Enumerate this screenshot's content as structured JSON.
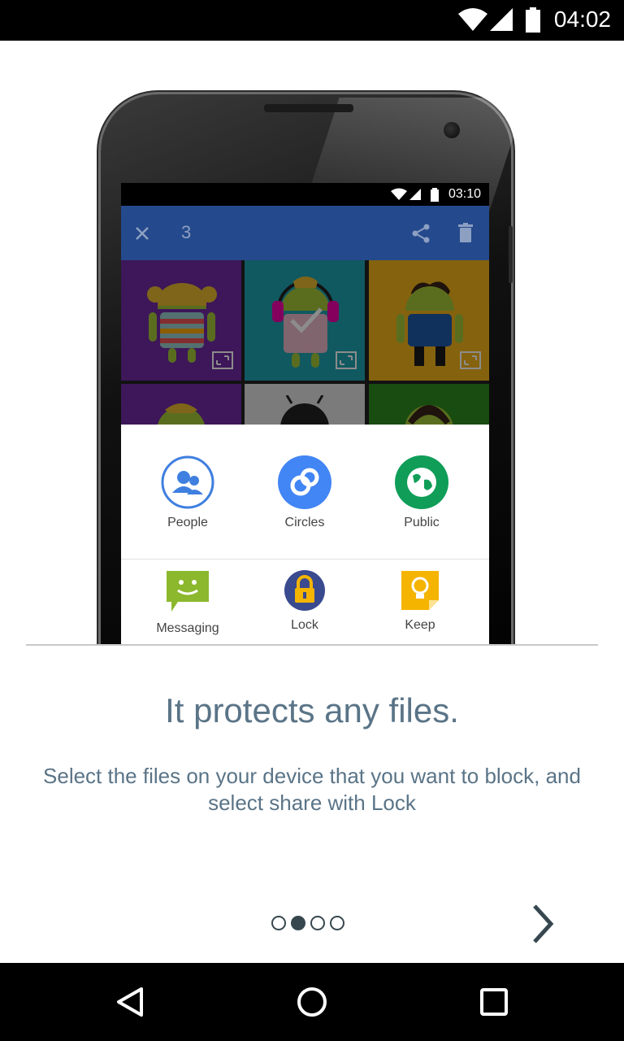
{
  "status_bar": {
    "time": "04:02"
  },
  "illustration": {
    "inner_status_time": "03:10",
    "inner_toolbar_count": "3",
    "share_items": [
      {
        "label": "People",
        "icon": "people-icon"
      },
      {
        "label": "Circles",
        "icon": "circles-icon"
      },
      {
        "label": "Public",
        "icon": "globe-icon"
      },
      {
        "label": "Messaging",
        "icon": "messaging-icon"
      },
      {
        "label": "Lock",
        "icon": "padlock-icon"
      },
      {
        "label": "Keep",
        "icon": "keep-bulb-icon"
      }
    ]
  },
  "content": {
    "headline": "It protects any files.",
    "description": "Select the files on your device that you want to block, and select share with Lock"
  },
  "pager": {
    "total_pages": 4,
    "current_page": 2
  },
  "colors": {
    "text": "#5a7487",
    "toolbar": "#24498c",
    "dot": "#37474f"
  }
}
